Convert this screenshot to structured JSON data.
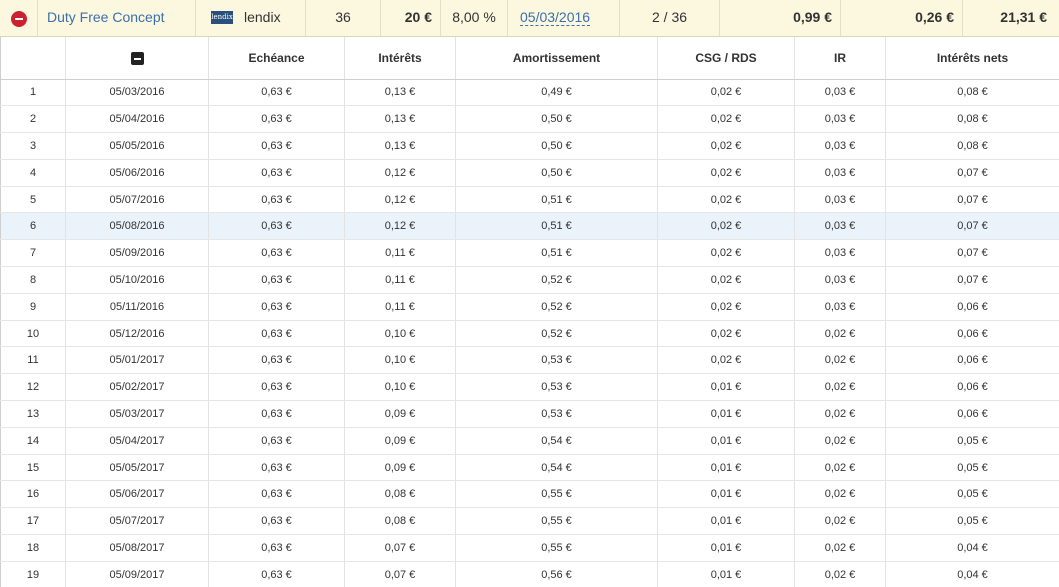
{
  "loan": {
    "project_name": "Duty Free Concept",
    "platform_logo_text": "lendix",
    "platform_name": "lendix",
    "duration": "36",
    "amount": "20 €",
    "rate": "8,00 %",
    "start_date": "05/03/2016",
    "progress": "2 / 36",
    "value1": "0,99 €",
    "value2": "0,26 €",
    "value3": "21,31 €"
  },
  "table": {
    "headers": {
      "num": "",
      "expand": "",
      "echeance": "Echéance",
      "interets": "Intérêts",
      "amortissement": "Amortissement",
      "csg": "CSG / RDS",
      "ir": "IR",
      "interets_nets": "Intérêts nets"
    },
    "highlighted_row": 6,
    "rows": [
      [
        "1",
        "05/03/2016",
        "0,63 €",
        "0,13 €",
        "0,49 €",
        "0,02 €",
        "0,03 €",
        "0,08 €"
      ],
      [
        "2",
        "05/04/2016",
        "0,63 €",
        "0,13 €",
        "0,50 €",
        "0,02 €",
        "0,03 €",
        "0,08 €"
      ],
      [
        "3",
        "05/05/2016",
        "0,63 €",
        "0,13 €",
        "0,50 €",
        "0,02 €",
        "0,03 €",
        "0,08 €"
      ],
      [
        "4",
        "05/06/2016",
        "0,63 €",
        "0,12 €",
        "0,50 €",
        "0,02 €",
        "0,03 €",
        "0,07 €"
      ],
      [
        "5",
        "05/07/2016",
        "0,63 €",
        "0,12 €",
        "0,51 €",
        "0,02 €",
        "0,03 €",
        "0,07 €"
      ],
      [
        "6",
        "05/08/2016",
        "0,63 €",
        "0,12 €",
        "0,51 €",
        "0,02 €",
        "0,03 €",
        "0,07 €"
      ],
      [
        "7",
        "05/09/2016",
        "0,63 €",
        "0,11 €",
        "0,51 €",
        "0,02 €",
        "0,03 €",
        "0,07 €"
      ],
      [
        "8",
        "05/10/2016",
        "0,63 €",
        "0,11 €",
        "0,52 €",
        "0,02 €",
        "0,03 €",
        "0,07 €"
      ],
      [
        "9",
        "05/11/2016",
        "0,63 €",
        "0,11 €",
        "0,52 €",
        "0,02 €",
        "0,03 €",
        "0,06 €"
      ],
      [
        "10",
        "05/12/2016",
        "0,63 €",
        "0,10 €",
        "0,52 €",
        "0,02 €",
        "0,02 €",
        "0,06 €"
      ],
      [
        "11",
        "05/01/2017",
        "0,63 €",
        "0,10 €",
        "0,53 €",
        "0,02 €",
        "0,02 €",
        "0,06 €"
      ],
      [
        "12",
        "05/02/2017",
        "0,63 €",
        "0,10 €",
        "0,53 €",
        "0,01 €",
        "0,02 €",
        "0,06 €"
      ],
      [
        "13",
        "05/03/2017",
        "0,63 €",
        "0,09 €",
        "0,53 €",
        "0,01 €",
        "0,02 €",
        "0,06 €"
      ],
      [
        "14",
        "05/04/2017",
        "0,63 €",
        "0,09 €",
        "0,54 €",
        "0,01 €",
        "0,02 €",
        "0,05 €"
      ],
      [
        "15",
        "05/05/2017",
        "0,63 €",
        "0,09 €",
        "0,54 €",
        "0,01 €",
        "0,02 €",
        "0,05 €"
      ],
      [
        "16",
        "05/06/2017",
        "0,63 €",
        "0,08 €",
        "0,55 €",
        "0,01 €",
        "0,02 €",
        "0,05 €"
      ],
      [
        "17",
        "05/07/2017",
        "0,63 €",
        "0,08 €",
        "0,55 €",
        "0,01 €",
        "0,02 €",
        "0,05 €"
      ],
      [
        "18",
        "05/08/2017",
        "0,63 €",
        "0,07 €",
        "0,55 €",
        "0,01 €",
        "0,02 €",
        "0,04 €"
      ],
      [
        "19",
        "05/09/2017",
        "0,63 €",
        "0,07 €",
        "0,56 €",
        "0,01 €",
        "0,02 €",
        "0,04 €"
      ]
    ]
  }
}
